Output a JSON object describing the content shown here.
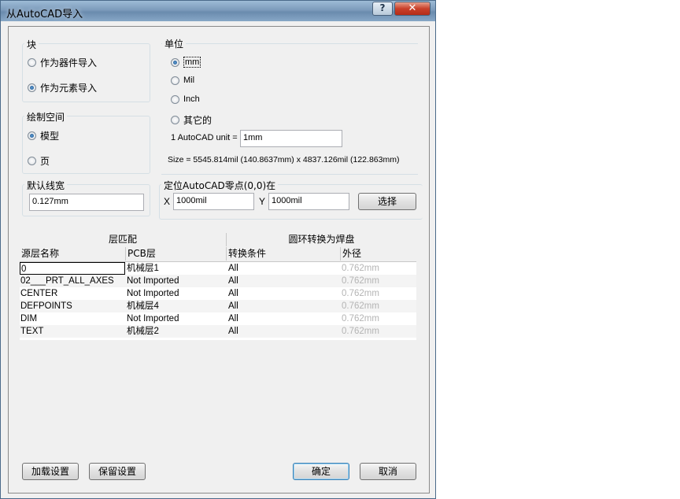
{
  "window": {
    "title": "从AutoCAD导入",
    "help_label": "?",
    "close_label": "✕"
  },
  "block": {
    "title": "块",
    "options": [
      {
        "label": "作为器件导入",
        "selected": false
      },
      {
        "label": "作为元素导入",
        "selected": true
      }
    ]
  },
  "units": {
    "title": "单位",
    "options": [
      {
        "label": "mm",
        "selected": true
      },
      {
        "label": "Mil",
        "selected": false
      },
      {
        "label": "Inch",
        "selected": false
      },
      {
        "label": "其它的",
        "selected": false
      }
    ],
    "unit_label": "1 AutoCAD unit =",
    "unit_value": "1mm",
    "size_text": "Size = 5545.814mil (140.8637mm) x 4837.126mil (122.863mm)"
  },
  "draw_space": {
    "title": "绘制空间",
    "options": [
      {
        "label": "模型",
        "selected": true
      },
      {
        "label": "页",
        "selected": false
      }
    ]
  },
  "default_width": {
    "title": "默认线宽",
    "value": "0.127mm"
  },
  "origin": {
    "title": "定位AutoCAD零点(0,0)在",
    "x_label": "X",
    "x_value": "1000mil",
    "y_label": "Y",
    "y_value": "1000mil",
    "select_label": "选择"
  },
  "layer_table": {
    "group1": "层匹配",
    "group2": "圆环转换为焊盘",
    "columns": [
      "源层名称",
      "PCB层",
      "转换条件",
      "外径"
    ],
    "rows": [
      [
        "0",
        "机械层1",
        "All",
        "0.762mm"
      ],
      [
        "02___PRT_ALL_AXES",
        "Not Imported",
        "All",
        "0.762mm"
      ],
      [
        "CENTER",
        "Not Imported",
        "All",
        "0.762mm"
      ],
      [
        "DEFPOINTS",
        "机械层4",
        "All",
        "0.762mm"
      ],
      [
        "DIM",
        "Not Imported",
        "All",
        "0.762mm"
      ],
      [
        "TEXT",
        "机械层2",
        "All",
        "0.762mm"
      ]
    ]
  },
  "footer": {
    "load_label": "加载设置",
    "save_label": "保留设置",
    "ok_label": "确定",
    "cancel_label": "取消"
  },
  "colors": {
    "titlebar": "#7c9bbb",
    "dialog_bg": "#f0f0f0",
    "close_button": "#c9402a"
  }
}
